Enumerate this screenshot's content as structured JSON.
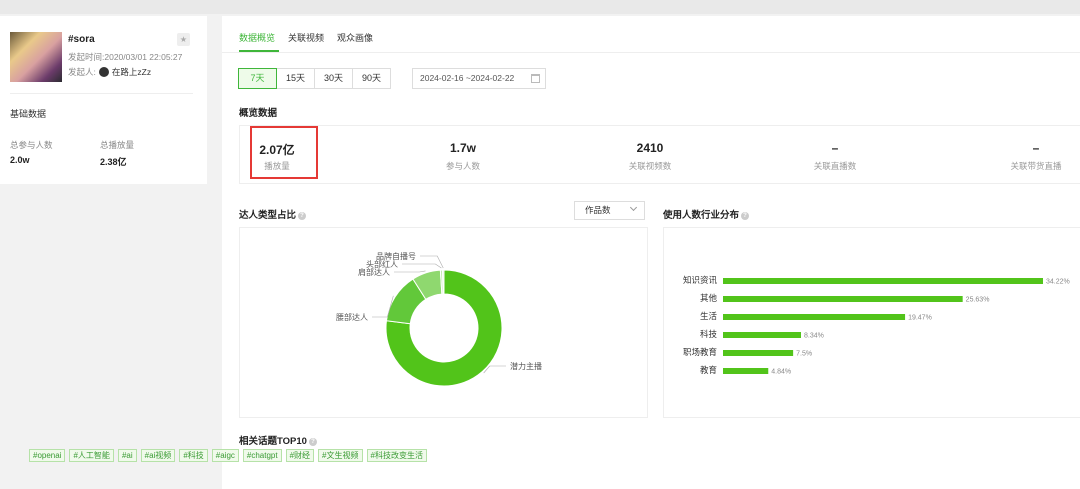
{
  "topic": {
    "name": "#sora",
    "date_label": "发起时间:",
    "date_value": "2020/03/01 22:05:27",
    "author_label": "发起人:",
    "author_name": "在路上zZz",
    "basic_title": "基础数据",
    "stats": [
      {
        "label": "总参与人数",
        "value": "2.0w"
      },
      {
        "label": "总播放量",
        "value": "2.38亿"
      }
    ]
  },
  "tabs": [
    {
      "label": "数据概览",
      "active": true
    },
    {
      "label": "关联视频",
      "active": false
    },
    {
      "label": "观众画像",
      "active": false
    }
  ],
  "periods": [
    {
      "label": "7天",
      "active": true
    },
    {
      "label": "15天",
      "active": false
    },
    {
      "label": "30天",
      "active": false
    },
    {
      "label": "90天",
      "active": false
    }
  ],
  "date_range": "2024-02-16 ~2024-02-22",
  "overview": {
    "title": "概览数据",
    "items": [
      {
        "value": "2.07亿",
        "label": "播放量",
        "highlighted": true
      },
      {
        "value": "1.7w",
        "label": "参与人数"
      },
      {
        "value": "2410",
        "label": "关联视频数"
      },
      {
        "value": "–",
        "label": "关联直播数"
      },
      {
        "value": "–",
        "label": "关联带货直播"
      }
    ]
  },
  "influencer": {
    "title": "达人类型占比",
    "dropdown": "作品数"
  },
  "industry": {
    "title": "使用人数行业分布"
  },
  "topics": {
    "title": "相关话题TOP10",
    "tags": [
      "#openai",
      "#人工智能",
      "#ai",
      "#ai视频",
      "#科技",
      "#aigc",
      "#chatgpt",
      "#财经",
      "#文生视频",
      "#科技改变生活"
    ]
  },
  "accent_color": "#3fb63a",
  "highlight_color": "#e53935",
  "chart_data": [
    {
      "type": "pie",
      "title": "达人类型占比",
      "donut": true,
      "categories": [
        "潜力主播",
        "腰部达人",
        "肩部达人",
        "头部红人",
        "品牌自播号"
      ],
      "values": [
        77,
        14,
        8,
        0.6,
        0.4
      ],
      "colors": [
        "#52c41a",
        "#62c83a",
        "#8fd86f",
        "#c2eab0",
        "#ddf3d1"
      ]
    },
    {
      "type": "bar",
      "orientation": "horizontal",
      "title": "使用人数行业分布",
      "categories": [
        "知识资讯",
        "其他",
        "生活",
        "科技",
        "职场教育",
        "教育"
      ],
      "values": [
        34.22,
        25.63,
        19.47,
        8.34,
        7.5,
        4.84
      ],
      "value_labels": [
        "34.22%",
        "25.63%",
        "19.47%",
        "8.34%",
        "7.5%",
        "4.84%"
      ],
      "xlim": [
        0,
        34.22
      ],
      "color": "#52c41a",
      "grid": false
    }
  ]
}
